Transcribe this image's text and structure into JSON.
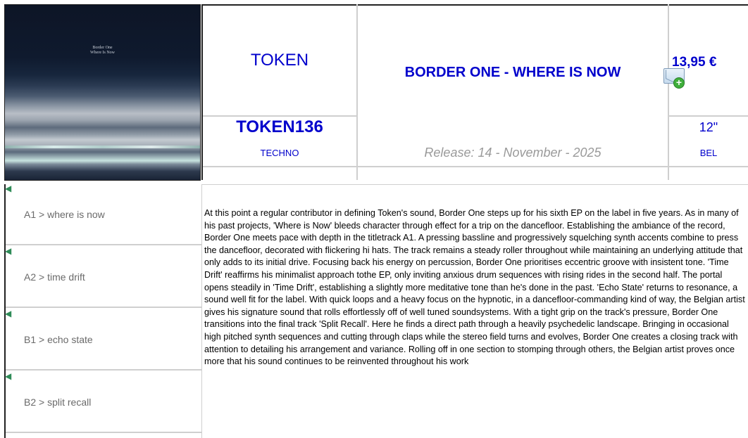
{
  "cover": {
    "line1": "Border One",
    "line2": "Where Is Now"
  },
  "release": {
    "label": "TOKEN",
    "title": "BORDER ONE - WHERE IS NOW",
    "price": "13,95 €",
    "catalog": "TOKEN136",
    "format": "12\"",
    "genre": "TECHNO",
    "release_date": "Release: 14 - November - 2025",
    "country": "BEL"
  },
  "icons": {
    "cart": "mail-add-icon",
    "speaker": "speaker-icon"
  },
  "colors": {
    "link": "#0000cc",
    "muted": "#9a9a9a",
    "track_text": "#6a6a6a"
  },
  "tracks": [
    {
      "name": "A1 > where is now"
    },
    {
      "name": "A2 > time drift"
    },
    {
      "name": "B1 > echo state"
    },
    {
      "name": "B2 > split recall"
    }
  ],
  "description": "At this point a regular contributor in defining Token's sound, Border One steps up for his sixth EP on the label in five years. As in many of his past projects, 'Where is Now' bleeds character through effect for a trip on the dancefloor. Establishing the ambiance of the record, Border One meets pace with depth in the titletrack A1. A pressing bassline and progressively squelching synth accents combine to press the dancefloor, decorated with flickering hi hats. The track remains a steady roller throughout while maintaining an underlying attitude that only adds to its initial drive. Focusing back his energy on percussion, Border One prioritises eccentric groove with insistent tone. 'Time Drift' reaffirms his minimalist approach tothe EP, only inviting anxious drum sequences with rising rides in the second half. The portal opens steadily in 'Time Drift', establishing a slightly more meditative tone than he's done in the past. 'Echo State' returns to resonance, a sound well fit for the label. With quick loops and a heavy focus on the hypnotic, in a dancefloor-commanding kind of way, the Belgian artist gives his signature sound that rolls effortlessly off of well tuned soundsystems. With a tight grip on the track's pressure, Border One transitions into the final track 'Split Recall'. Here he finds a direct path through a heavily psychedelic landscape. Bringing in occasional high pitched synth sequences and cutting through claps while the stereo field turns and evolves, Border One creates a closing track with attention to detailing his arrangement and variance. Rolling off in one section to stomping through others, the Belgian artist proves once more that his sound continues to be reinvented throughout his work"
}
